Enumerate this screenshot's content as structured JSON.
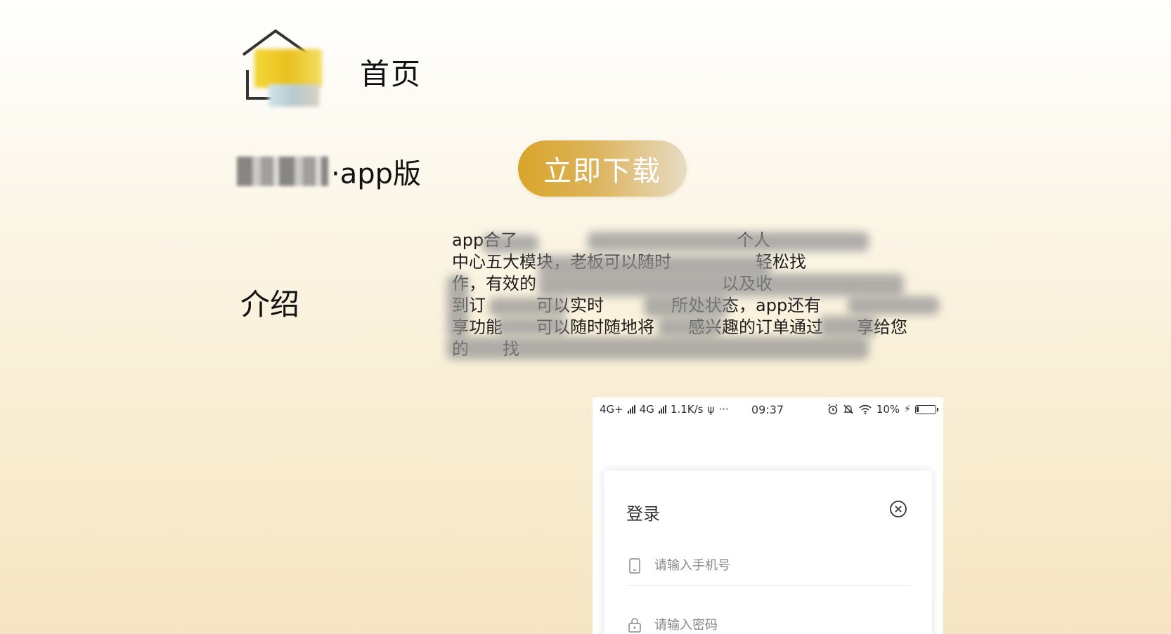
{
  "header": {
    "home_title": "首页",
    "logo_icon": "app-logo-icon"
  },
  "app": {
    "name_suffix": "·app版",
    "download_label": "立即下载",
    "download_gradient": [
      "#d9a52b",
      "#e8dcc4"
    ]
  },
  "intro": {
    "label": "介绍",
    "lines": [
      "app合了　　　　　　　　　　　　　个人",
      "中心五大模块，老板可以随时　　　　　轻松找",
      "作，有效的　　　　　　　　　　　以及收",
      "到订　　　可以实时　　　　所处状态，app还有",
      "享功能　　可以随时随地将　　感兴趣的订单通过　　享给您",
      "的　　找"
    ]
  },
  "phone": {
    "status_left": "4G+",
    "status_left2": "4G",
    "speed": "1.1K/s",
    "usb": "ψ",
    "dots": "···",
    "time": "09:37",
    "battery": "10%",
    "login": {
      "title": "登录",
      "phone_placeholder": "请输入手机号",
      "password_placeholder": "请输入密码"
    }
  }
}
